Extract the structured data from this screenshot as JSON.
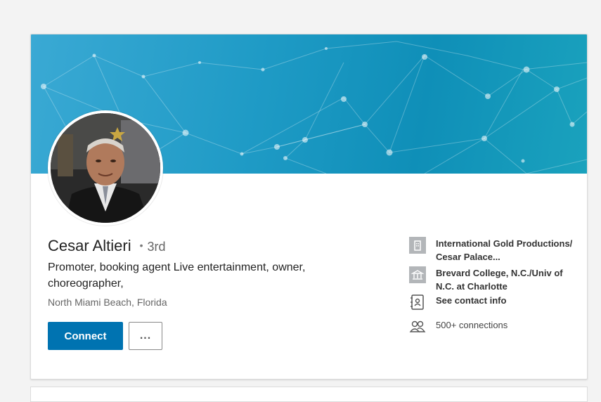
{
  "profile": {
    "name": "Cesar Altieri",
    "degree_separator": "•",
    "degree": "3rd",
    "headline": "Promoter, booking agent Live entertainment, owner, choreographer,",
    "location": "North Miami Beach, Florida"
  },
  "actions": {
    "connect_label": "Connect",
    "more_label": "..."
  },
  "sidebar": {
    "company": "International Gold Productions/ Cesar Palace...",
    "education": "Brevard College, N.C./Univ of N.C. at Charlotte",
    "contact_info": "See contact info",
    "connections": "500+ connections"
  },
  "colors": {
    "accent": "#0073b1",
    "banner": "#1f9bc6"
  },
  "icons": [
    "building-icon",
    "school-icon",
    "contact-card-icon",
    "people-icon"
  ]
}
